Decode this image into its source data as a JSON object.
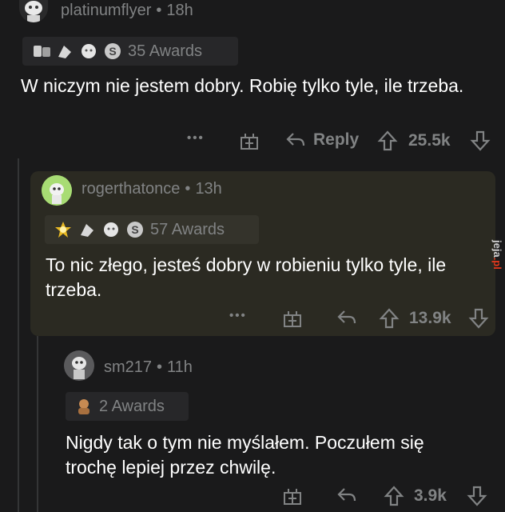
{
  "comments": [
    {
      "username": "platinumflyer",
      "time": "18h",
      "awards_label": "35 Awards",
      "text": "W niczym nie jestem dobry. Robię tylko tyle, ile trzeba.",
      "actions": {
        "more": "•••",
        "reply": "Reply",
        "score": "25.5k"
      }
    },
    {
      "username": "rogerthatonce",
      "time": "13h",
      "awards_label": "57 Awards",
      "text": "To nic złego, jesteś dobry w robieniu tylko tyle, ile trzeba.",
      "actions": {
        "more": "•••",
        "score": "13.9k"
      }
    },
    {
      "username": "sm217",
      "time": "11h",
      "awards_label": "2 Awards",
      "text": "Nigdy tak o tym nie myślałem. Poczułem się trochę lepiej przez chwilę.",
      "actions": {
        "score": "3.9k"
      }
    }
  ],
  "separator": "•",
  "watermark": {
    "main": "jeja",
    "suffix": ".pl"
  },
  "colors": {
    "background": "#1a1a1b",
    "highlight": "#2b2a22",
    "text": "#ffffff",
    "meta": "#818384",
    "watermark_accent": "#e5391c"
  }
}
